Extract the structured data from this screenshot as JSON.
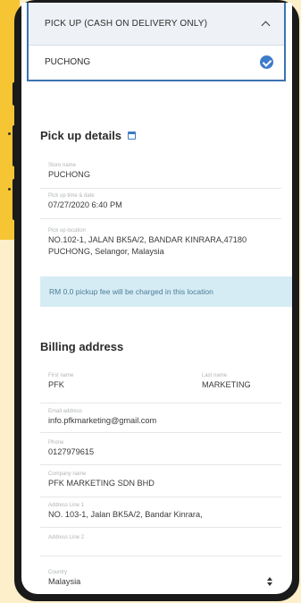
{
  "pickup": {
    "header_label": "PICK UP (CASH ON DELIVERY ONLY)",
    "selected_option": "PUCHONG"
  },
  "pickup_details": {
    "title": "Pick up details",
    "store": {
      "label": "Store name",
      "value": "PUCHONG"
    },
    "datetime": {
      "label": "Pick up time & date",
      "value": "07/27/2020 6:40 PM"
    },
    "location": {
      "label": "Pick up location",
      "value_line1": "NO.102-1, JALAN BK5A/2, BANDAR KINRARA,47180",
      "value_line2": "PUCHONG, Selangor, Malaysia"
    },
    "fee_notice": "RM 0.0 pickup fee will be charged in this location"
  },
  "billing": {
    "title": "Billing address",
    "first_name": {
      "label": "First name",
      "value": "PFK"
    },
    "last_name": {
      "label": "Last name",
      "value": "MARKETING"
    },
    "email": {
      "label": "Email address",
      "value": "info.pfkmarketing@gmail.com"
    },
    "phone": {
      "label": "Phone",
      "value": "0127979615"
    },
    "company": {
      "label": "Company name",
      "value": "PFK MARKETING SDN BHD"
    },
    "address1": {
      "label": "Address Line 1",
      "value": "NO. 103-1, Jalan BK5A/2, Bandar Kinrara,"
    },
    "address2": {
      "label": "Address Line 2",
      "value": ""
    },
    "country": {
      "label": "Country",
      "value": "Malaysia"
    }
  },
  "colors": {
    "accent": "#3d7cc9",
    "frame_border": "#3c73b1",
    "info_bg": "#d6ecf5",
    "page_bg": "#fcefc9",
    "side_panel": "#f6c534"
  }
}
